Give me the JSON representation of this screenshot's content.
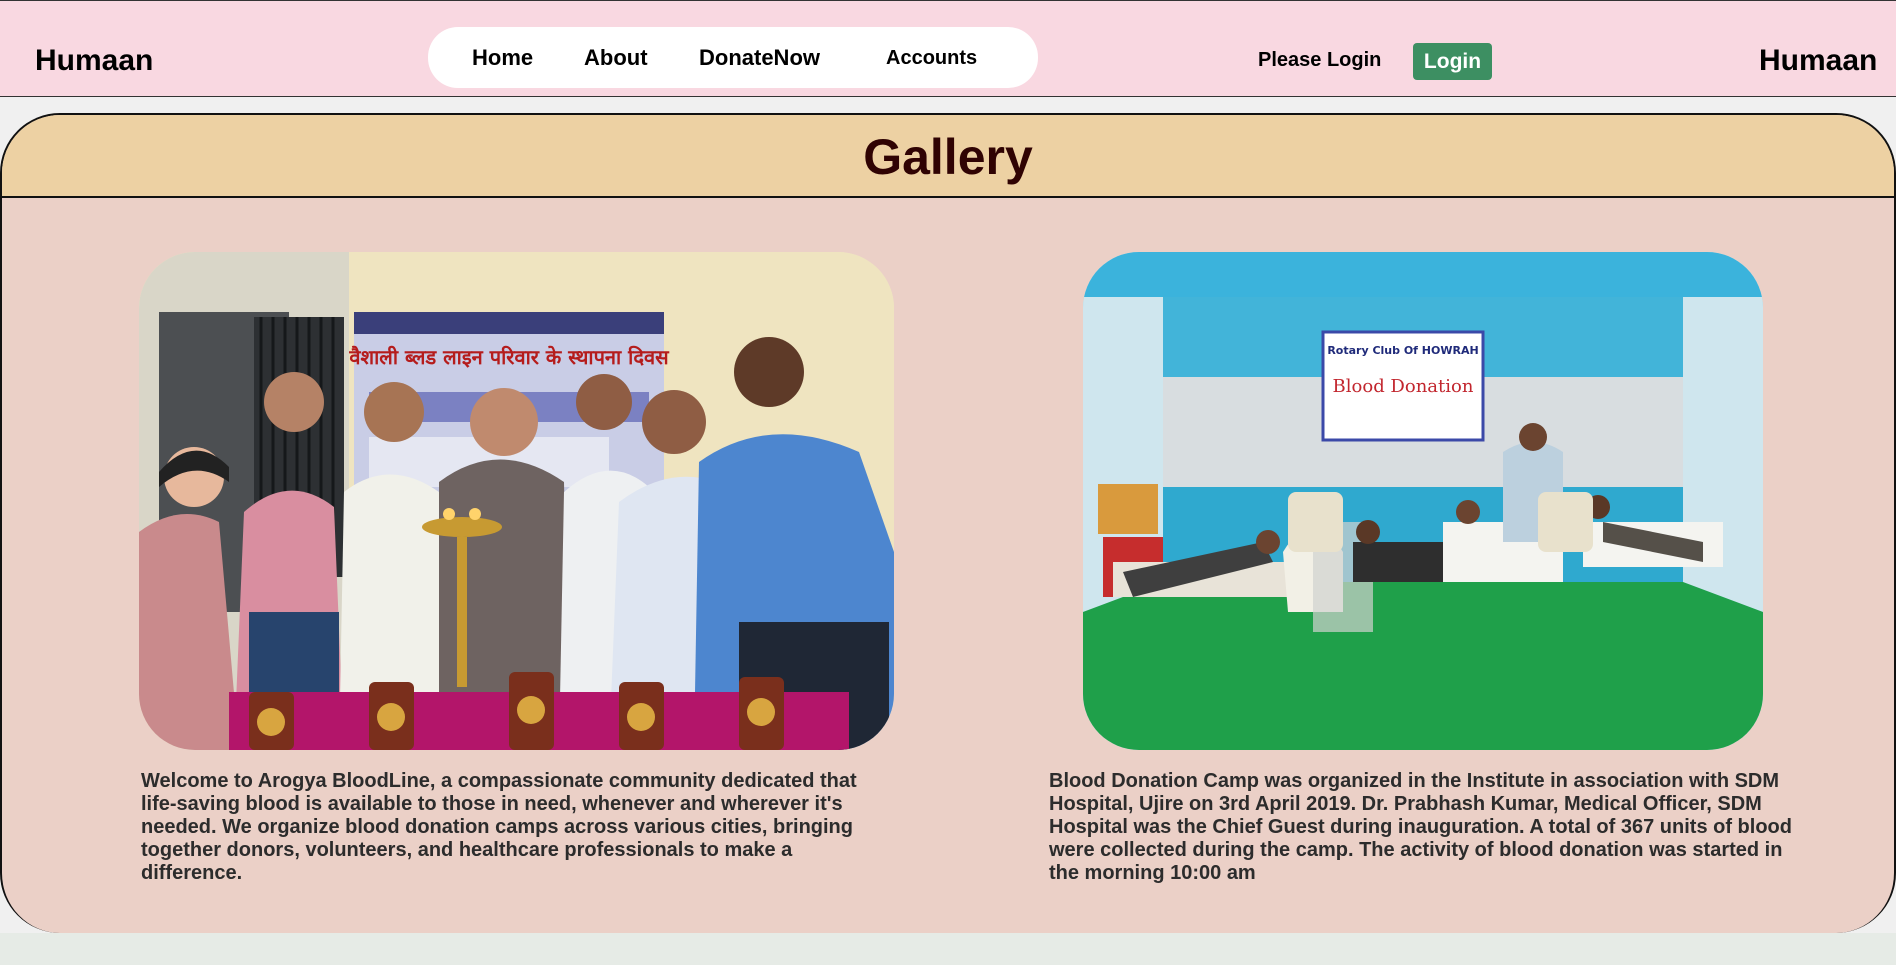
{
  "header": {
    "brand_left": "Humaan",
    "brand_right": "Humaan",
    "nav": {
      "home": "Home",
      "about": "About",
      "donate": "DonateNow",
      "accounts": "Accounts"
    },
    "status_text": "Please Login",
    "login_label": "Login",
    "colors": {
      "header_bg": "#f9d8e1",
      "login_bg": "#3d8f62"
    }
  },
  "gallery": {
    "title": "Gallery",
    "items": [
      {
        "image_label": "blood-camp-lamp-lighting-photo",
        "banner_text": "वैशाली ब्लड लाइन परिवार के स्थापना दिवस",
        "caption": "Welcome to Arogya BloodLine, a compassionate community dedicated that life-saving blood is available to those in need, whenever and wherever it's needed. We organize blood donation camps across various cities, bringing together donors, volunteers, and healthcare professionals to make a difference."
      },
      {
        "image_label": "blood-donation-camp-tent-photo",
        "banner_title": "Blood Donation",
        "banner_org": "Rotary Club Of HOWRAH",
        "caption": "Blood Donation Camp was organized in the Institute in association with SDM Hospital, Ujire on 3rd April 2019. Dr. Prabhash Kumar, Medical Officer, SDM Hospital was the Chief Guest during inauguration. A total of 367 units of blood were collected during the camp. The activity of blood donation was started in the morning 10:00 am"
      }
    ],
    "colors": {
      "card_bg": "#ebd0c7",
      "title_bar_bg": "#edd1a3",
      "title_color": "#300303"
    }
  }
}
